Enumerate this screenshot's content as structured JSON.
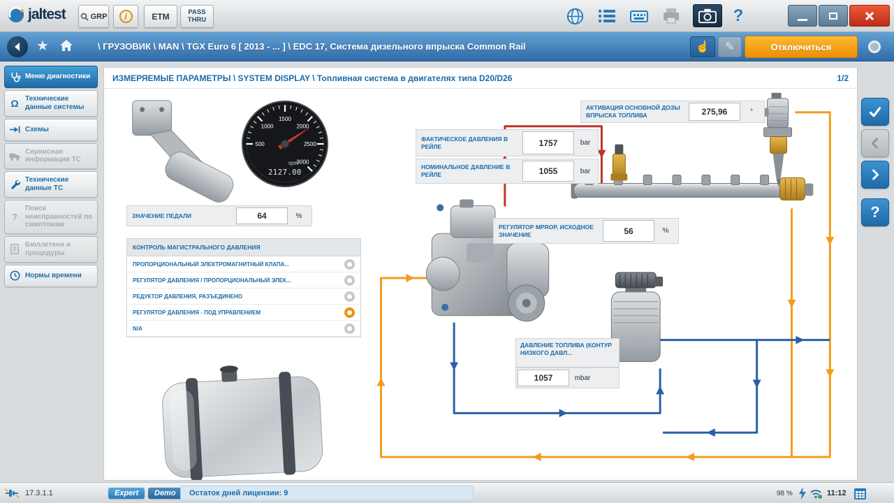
{
  "app": {
    "brand": "jaltest",
    "toolbar": {
      "grp": "GRP",
      "etm": "ETM",
      "passthru": "PASS THRU"
    }
  },
  "breadcrumb": {
    "path": "\\ ГРУЗОВИК \\ MAN \\ TGX Euro 6 [ 2013 - ... ] \\ EDC 17, Система дизельного впрыска Common Rail",
    "disconnect_label": "Отключиться"
  },
  "sidebar": {
    "items": [
      {
        "label": "Меню диагностики",
        "state": "active"
      },
      {
        "label": "Технические данные системы",
        "state": "enabled"
      },
      {
        "label": "Схемы",
        "state": "enabled"
      },
      {
        "label": "Сервисная информация ТС",
        "state": "disabled"
      },
      {
        "label": "Технические данные ТС",
        "state": "enabled"
      },
      {
        "label": "Поиск неисправностей по симптомам",
        "state": "disabled"
      },
      {
        "label": "Бюллетени и процедуры",
        "state": "disabled"
      },
      {
        "label": "Нормы времени",
        "state": "enabled"
      }
    ]
  },
  "main": {
    "title": "ИЗМЕРЯЕМЫЕ ПАРАМЕТРЫ \\ SYSTEM DISPLAY \\ Топливная система в двигателях типа D20/D26",
    "page_indicator": "1/2",
    "gauge": {
      "unit": "rpm",
      "display": "2127.00",
      "value": 2127,
      "min": 500,
      "max": 3000,
      "tick_labels": [
        "500",
        "1000",
        "1500",
        "2000",
        "2500",
        "3000"
      ]
    },
    "pedal_param": {
      "label": "ЗНАЧЕНИЕ ПЕДАЛИ",
      "value": "64",
      "unit": "%"
    },
    "injection_param": {
      "label": "АКТИВАЦИЯ ОСНОВНОЙ ДОЗЫ ВПРЫСКА ТОПЛИВА",
      "value": "275,96",
      "unit": "°"
    },
    "actual_rail_param": {
      "label": "ФАКТИЧЕСКОЕ ДАВЛЕНИЯ В РЕЙЛЕ",
      "value": "1757",
      "unit": "bar"
    },
    "nominal_rail_param": {
      "label": "НОМИНАЛЬНОЕ ДАВЛЕНИЕ В РЕЙЛЕ",
      "value": "1055",
      "unit": "bar"
    },
    "mprop_param": {
      "label": "РЕГУЛЯТОР MPROP, ИСХОДНОЕ ЗНАЧЕНИЕ",
      "value": "56",
      "unit": "%"
    },
    "low_pressure_param": {
      "label": "ДАВЛЕНИЕ ТОПЛИВА (КОНТУР НИЗКОГО ДАВЛ...",
      "value": "1057",
      "unit": "mbar"
    },
    "pressure_control": {
      "title": "КОНТРОЛЬ МАГИСТРАЛЬНОГО ДАВЛЕНИЯ",
      "options": [
        {
          "label": "ПРОПОРЦИОНАЛЬНЫЙ ЭЛЕКТРОМАГНИТНЫЙ КЛАПА...",
          "selected": false
        },
        {
          "label": "РЕГУЛЯТОР ДАВЛЕНИЯ / ПРОПОРЦИОНАЛЬНЫЙ ЭЛЕК...",
          "selected": false
        },
        {
          "label": "РЕДУКТОР ДАВЛЕНИЯ, РАЗЪЕДИНЕНО",
          "selected": false
        },
        {
          "label": "РЕГУЛЯТОР ДАВЛЕНИЯ - ПОД УПРАВЛЕНИЕМ",
          "selected": true
        },
        {
          "label": "N/A",
          "selected": false
        }
      ]
    }
  },
  "statusbar": {
    "version": "17.3.1.1",
    "expert_badge": "Expert",
    "demo_badge": "Demo",
    "license_text": "Остаток дней лицензии: 9",
    "battery": "98 %",
    "time": "11:12"
  },
  "glyphs": {
    "help": "?",
    "info": "i",
    "star": "★",
    "hand": "☝",
    "pencil": "✎",
    "omega": "Ω"
  },
  "colors": {
    "accent_orange": "#f59b1e",
    "pipe_blue": "#2c5faa",
    "pipe_red": "#b8372a",
    "active_blue": "#2e7fc0"
  }
}
